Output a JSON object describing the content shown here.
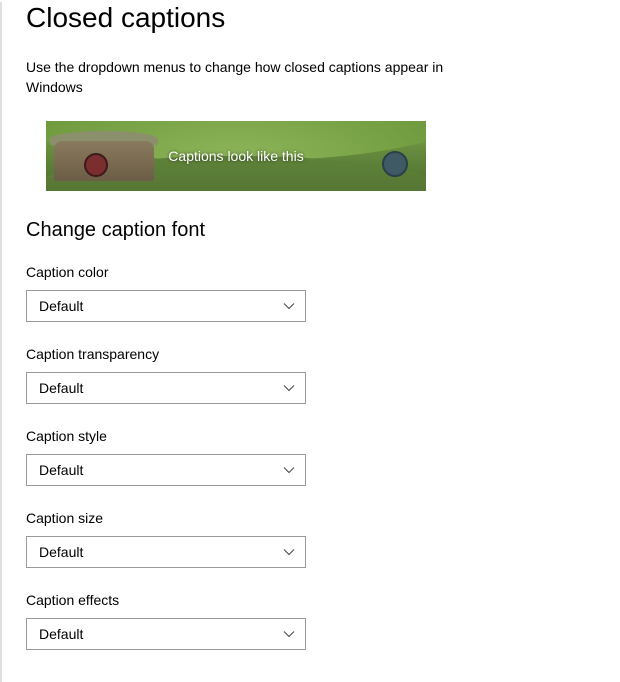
{
  "title": "Closed captions",
  "description": "Use the dropdown menus to change how closed captions appear in Windows",
  "preview_caption": "Captions look like this",
  "section_title": "Change caption font",
  "fields": {
    "caption_color": {
      "label": "Caption color",
      "value": "Default"
    },
    "caption_transparency": {
      "label": "Caption transparency",
      "value": "Default"
    },
    "caption_style": {
      "label": "Caption style",
      "value": "Default"
    },
    "caption_size": {
      "label": "Caption size",
      "value": "Default"
    },
    "caption_effects": {
      "label": "Caption effects",
      "value": "Default"
    }
  }
}
